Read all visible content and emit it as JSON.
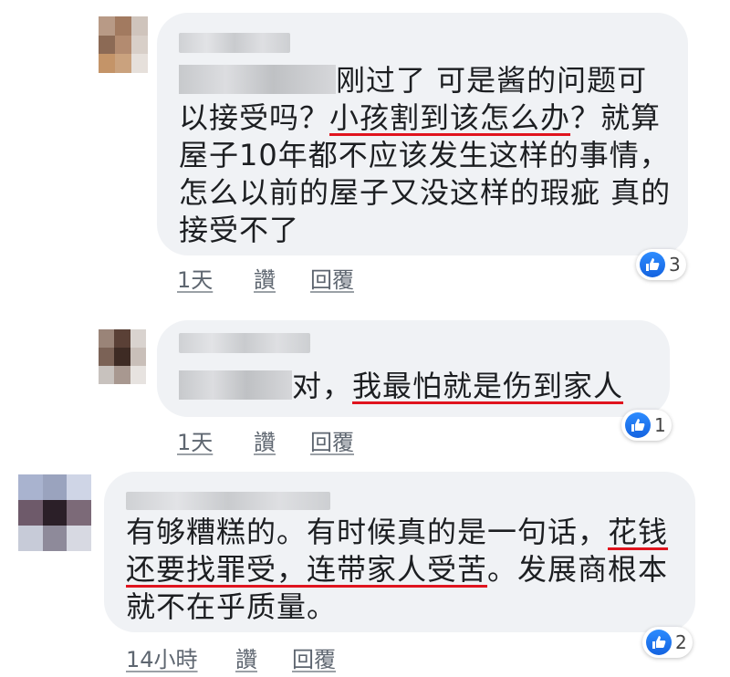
{
  "comments": [
    {
      "text_before": "刚过了 可是酱的问题可以接受吗？",
      "text_underlined": "小孩割到该怎么办",
      "text_after": "？就算屋子10年都不应该发生这样的事情，怎么以前的屋子又没这样的瑕疵 真的接受不了",
      "time": "1天",
      "like_label": "讚",
      "reply_label": "回覆",
      "reactions": "3"
    },
    {
      "text_before": "对，",
      "text_underlined": "我最怕就是伤到家人",
      "time": "1天",
      "like_label": "讚",
      "reply_label": "回覆",
      "reactions": "1"
    },
    {
      "text_before": "有够糟糕的。有时候真的是一句话，",
      "text_underlined": "花钱还要找罪受，连带家人受苦",
      "text_after": "。发展商根本就不在乎质量。",
      "time": "14小時",
      "like_label": "讚",
      "reply_label": "回覆",
      "reactions": "2"
    }
  ],
  "colors": {
    "bubble": "#f0f2f5",
    "underline": "#e0141e",
    "like": "#1877f2"
  },
  "icons": {
    "reaction": "thumbs-up-icon"
  }
}
